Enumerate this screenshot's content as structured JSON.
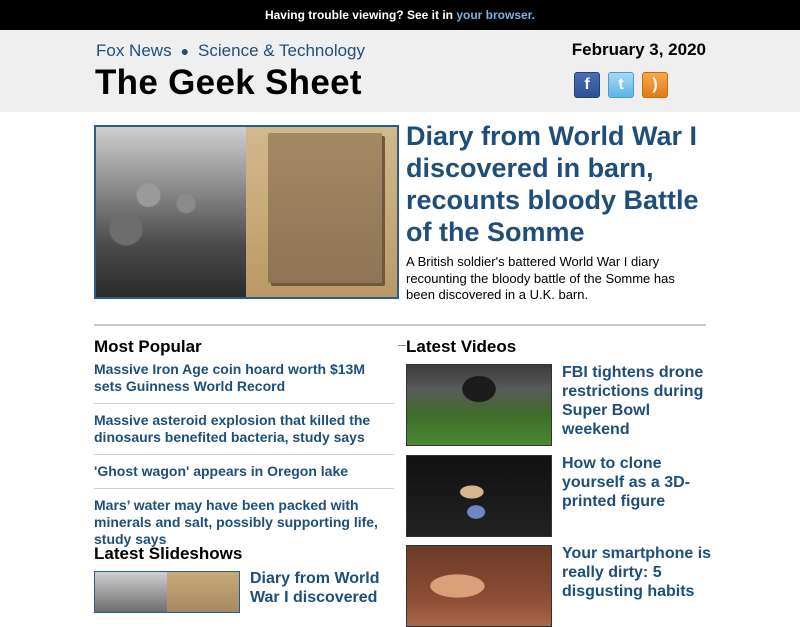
{
  "topbar": {
    "message": "Having trouble viewing? See it in ",
    "link": "your browser."
  },
  "header": {
    "section": "Fox News",
    "subsection": "Science & Technology",
    "date": "February 3, 2020",
    "title": "The Geek Sheet",
    "social": [
      "facebook-icon",
      "twitter-icon",
      "rss-icon"
    ]
  },
  "lead": {
    "headline": "Diary from World War I discovered in barn, recounts bloody Battle of the Somme",
    "summary": "A British soldier's battered World War I diary recounting the bloody battle of the Somme has been discovered in a U.K. barn."
  },
  "most_popular": {
    "title": "Most Popular",
    "items": [
      "Massive Iron Age coin hoard worth $13M sets Guinness World Record",
      "Massive asteroid explosion that killed the dinosaurs benefited bacteria, study says",
      "'Ghost wagon' appears in Oregon lake",
      "Mars’ water may have been packed with minerals and salt, possibly supporting life, study says"
    ]
  },
  "latest_videos": {
    "title": "Latest Videos",
    "items": [
      "FBI tightens drone restrictions during Super Bowl weekend",
      "How to clone yourself as a 3D-printed figure",
      "Your smartphone is really dirty: 5 disgusting habits"
    ]
  },
  "latest_slideshows": {
    "title": "Latest Slideshows",
    "items": [
      "Diary from World War I discovered"
    ]
  }
}
